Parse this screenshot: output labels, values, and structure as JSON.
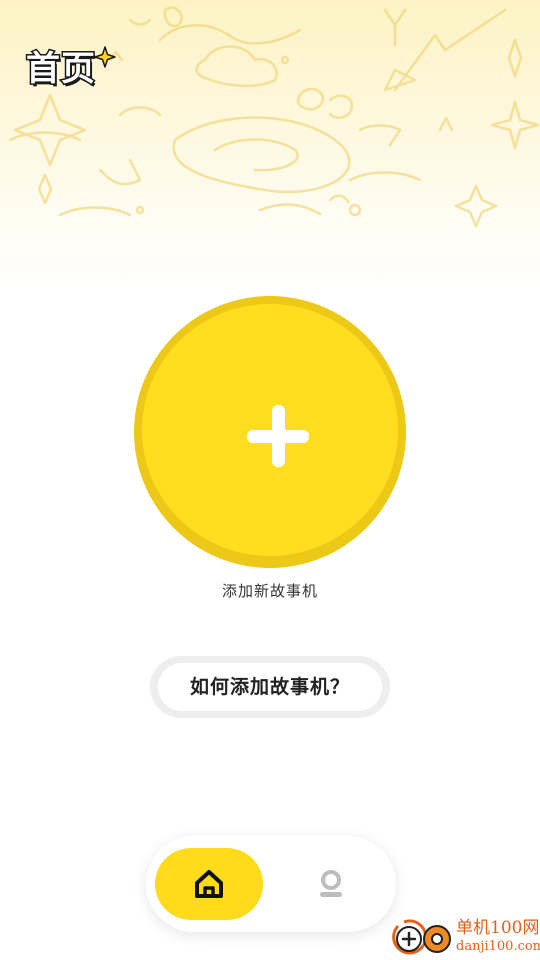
{
  "header": {
    "title": "首页",
    "sparkle_icon": "sparkle-icon",
    "background_color": "#fdf3c4"
  },
  "main": {
    "add_button_icon": "plus-icon",
    "add_button_color": "#ffde1f",
    "add_label": "添加新故事机",
    "help_button_label": "如何添加故事机？"
  },
  "bottom_nav": {
    "items": [
      {
        "name": "home",
        "icon": "home-icon",
        "active": true
      },
      {
        "name": "profile",
        "icon": "profile-icon",
        "active": false
      }
    ],
    "active_color": "#ffdb1c"
  },
  "watermark": {
    "name": "单机100网",
    "domain": "danji100.com",
    "color": "#e2621b"
  }
}
